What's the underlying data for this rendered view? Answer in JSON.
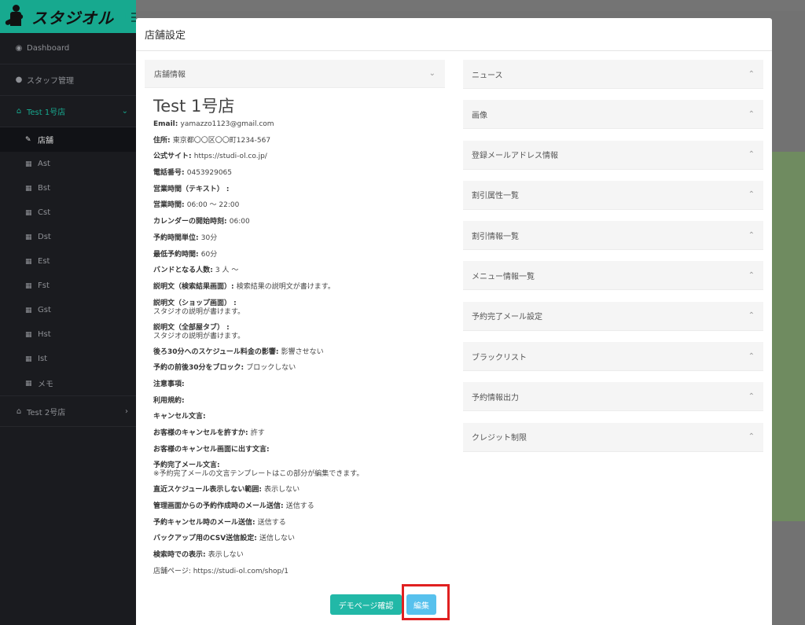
{
  "sidebar": {
    "logo_text": "スタジオル",
    "items": [
      {
        "icon": "dashboard-icon",
        "glyph": "◉",
        "label": "Dashboard"
      },
      {
        "icon": "user-icon",
        "glyph": "●",
        "label": "スタッフ管理"
      }
    ],
    "store1": {
      "label": "Test 1号店",
      "glyph": "⌂",
      "chevron": "⌄"
    },
    "sub_items": [
      {
        "label": "店舗",
        "glyph": "✎",
        "active": true
      },
      {
        "label": "Ast",
        "glyph": "▦"
      },
      {
        "label": "Bst",
        "glyph": "▦"
      },
      {
        "label": "Cst",
        "glyph": "▦"
      },
      {
        "label": "Dst",
        "glyph": "▦"
      },
      {
        "label": "Est",
        "glyph": "▦"
      },
      {
        "label": "Fst",
        "glyph": "▦"
      },
      {
        "label": "Gst",
        "glyph": "▦"
      },
      {
        "label": "Hst",
        "glyph": "▦"
      },
      {
        "label": "Ist",
        "glyph": "▦"
      },
      {
        "label": "メモ",
        "glyph": "▦"
      }
    ],
    "store2": {
      "label": "Test 2号店",
      "glyph": "⌂",
      "chevron": "›"
    }
  },
  "modal": {
    "title": "店舗設定",
    "info_panel_title": "店舗情報",
    "store_name": "Test 1号店",
    "rows": [
      {
        "k": "Email",
        "sep": ": ",
        "v": "yamazzo1123@gmail.com"
      },
      {
        "k": "住所",
        "sep": ": ",
        "v": "東京都〇〇区〇〇町1234-567"
      },
      {
        "k": "公式サイト",
        "sep": ": ",
        "v": "https://studi-ol.co.jp/"
      },
      {
        "k": "電話番号",
        "sep": ": ",
        "v": "0453929065"
      },
      {
        "k": "営業時間（テキスト）",
        "sep": " :",
        "v": ""
      },
      {
        "k": "営業時間",
        "sep": ": ",
        "v": "06:00 ～ 22:00"
      },
      {
        "k": "カレンダーの開始時刻",
        "sep": ": ",
        "v": "06:00"
      },
      {
        "k": "予約時間単位",
        "sep": ": ",
        "v": "30分"
      },
      {
        "k": "最低予約時間",
        "sep": ": ",
        "v": "60分"
      },
      {
        "k": "バンドとなる人数",
        "sep": ": ",
        "v": "3 人 ～"
      },
      {
        "k": "説明文（検索結果画面）",
        "sep": ": ",
        "v": "検索結果の説明文が書けます。"
      },
      {
        "k": "説明文（ショップ画面）",
        "sep": " :",
        "v2": "スタジオの説明が書けます。"
      },
      {
        "k": "説明文（全部屋タブ）",
        "sep": " :",
        "v2": "スタジオの説明が書けます。"
      },
      {
        "k": "後ろ30分へのスケジュール料金の影響",
        "sep": ": ",
        "v": "影響させない"
      },
      {
        "k": "予約の前後30分をブロック",
        "sep": ": ",
        "v": "ブロックしない"
      },
      {
        "k": "注意事項",
        "sep": ":",
        "v": ""
      },
      {
        "k": "利用規約",
        "sep": ":",
        "v": ""
      },
      {
        "k": "キャンセル文言",
        "sep": ":",
        "v": ""
      },
      {
        "k": "お客様のキャンセルを許すか",
        "sep": ": ",
        "v": "許す"
      },
      {
        "k": "お客様のキャンセル画面に出す文言",
        "sep": ":",
        "v": ""
      },
      {
        "k": "予約完了メール文言",
        "sep": ":",
        "v2": "※予約完了メールの文言テンプレートはこの部分が編集できます。"
      },
      {
        "k": "直近スケジュール表示しない範囲",
        "sep": ": ",
        "v": "表示しない"
      },
      {
        "k": "管理画面からの予約作成時のメール送信",
        "sep": ": ",
        "v": "送信する"
      },
      {
        "k": "予約キャンセル時のメール送信",
        "sep": ": ",
        "v": "送信する"
      },
      {
        "k": "バックアップ用のCSV送信設定",
        "sep": ": ",
        "v": "送信しない"
      },
      {
        "k": "検索時での表示",
        "sep": ": ",
        "v": "表示しない"
      },
      {
        "k": "",
        "sep": "",
        "v": "店舗ページ: https://studi-ol.com/shop/1"
      }
    ],
    "demo_button": "デモページ確認",
    "edit_button": "編集",
    "accordions": [
      "ニュース",
      "画像",
      "登録メールアドレス情報",
      "割引属性一覧",
      "割引情報一覧",
      "メニュー情報一覧",
      "予約完了メール設定",
      "ブラックリスト",
      "予約情報出力",
      "クレジット制限"
    ],
    "chevron_down": "⌄",
    "chevron_up": "⌃"
  }
}
